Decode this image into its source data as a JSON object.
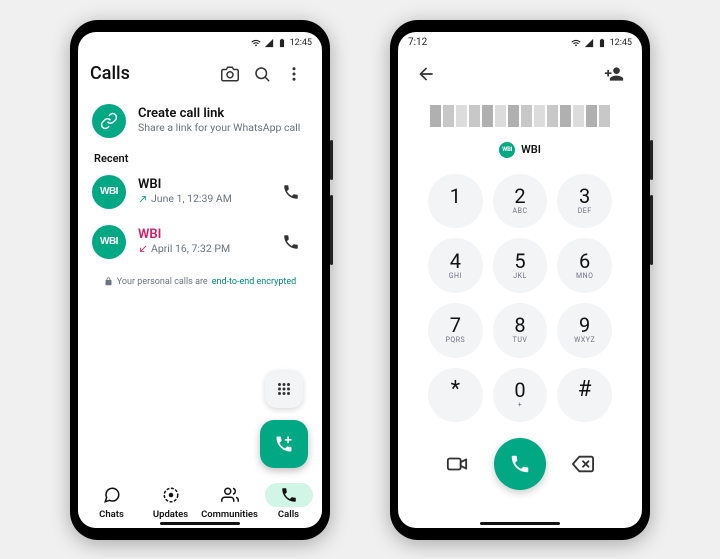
{
  "phone_left": {
    "status": {
      "time": "12:45"
    },
    "header": {
      "title": "Calls"
    },
    "create_link": {
      "title": "Create call link",
      "subtitle": "Share a link for your WhatsApp call"
    },
    "recent_label": "Recent",
    "calls": [
      {
        "name": "WBI",
        "avatar_text": "WBI",
        "time": "June 1, 12:39 AM",
        "direction": "outgoing",
        "missed": false
      },
      {
        "name": "WBI",
        "avatar_text": "WBI",
        "time": "April 16, 7:32 PM",
        "direction": "incoming",
        "missed": true
      }
    ],
    "encryption": {
      "prefix": "Your personal calls are ",
      "link": "end-to-end encrypted"
    },
    "nav": {
      "items": [
        {
          "label": "Chats"
        },
        {
          "label": "Updates"
        },
        {
          "label": "Communities"
        },
        {
          "label": "Calls"
        }
      ],
      "active_index": 3
    }
  },
  "phone_right": {
    "status": {
      "time": "7:12",
      "time_right": "12:45"
    },
    "contact": {
      "name": "WBI",
      "avatar_text": "WBI"
    },
    "dialpad": [
      {
        "digit": "1",
        "letters": ""
      },
      {
        "digit": "2",
        "letters": "ABC"
      },
      {
        "digit": "3",
        "letters": "DEF"
      },
      {
        "digit": "4",
        "letters": "GHI"
      },
      {
        "digit": "5",
        "letters": "JKL"
      },
      {
        "digit": "6",
        "letters": "MNO"
      },
      {
        "digit": "7",
        "letters": "PQRS"
      },
      {
        "digit": "8",
        "letters": "TUV"
      },
      {
        "digit": "9",
        "letters": "WXYZ"
      },
      {
        "digit": "*",
        "letters": ""
      },
      {
        "digit": "0",
        "letters": "+"
      },
      {
        "digit": "#",
        "letters": ""
      }
    ]
  },
  "colors": {
    "accent": "#00a884",
    "missed": "#d81b60"
  }
}
